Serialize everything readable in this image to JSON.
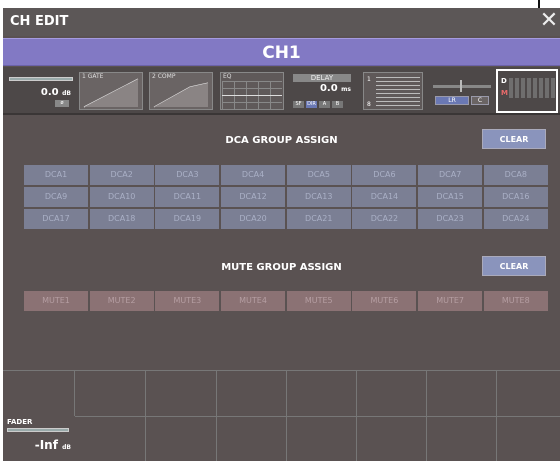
{
  "window": {
    "title": "CH EDIT",
    "close_glyph": "✕"
  },
  "channel": {
    "name": "CH1"
  },
  "strip": {
    "gain": {
      "value": "0.0",
      "unit": "dB",
      "phase_label": "ø"
    },
    "gate": {
      "label": "1 GATE"
    },
    "comp": {
      "label": "2 COMP"
    },
    "eq": {
      "label": "EQ"
    },
    "delay": {
      "label": "DELAY",
      "value": "0.0",
      "unit": "ms",
      "sw": [
        "SF",
        "DIR",
        "A",
        "B"
      ]
    },
    "insert": {
      "top": "1",
      "bottom": "8"
    },
    "pan": {
      "lr": "LR",
      "c": "C"
    },
    "assign": {
      "d": "D",
      "m": "M"
    }
  },
  "dca_section": {
    "title": "DCA GROUP ASSIGN",
    "clear_label": "CLEAR",
    "buttons": [
      "DCA1",
      "DCA2",
      "DCA3",
      "DCA4",
      "DCA5",
      "DCA6",
      "DCA7",
      "DCA8",
      "DCA9",
      "DCA10",
      "DCA11",
      "DCA12",
      "DCA13",
      "DCA14",
      "DCA15",
      "DCA16",
      "DCA17",
      "DCA18",
      "DCA19",
      "DCA20",
      "DCA21",
      "DCA22",
      "DCA23",
      "DCA24"
    ]
  },
  "mute_section": {
    "title": "MUTE GROUP ASSIGN",
    "clear_label": "CLEAR",
    "buttons": [
      "MUTE1",
      "MUTE2",
      "MUTE3",
      "MUTE4",
      "MUTE5",
      "MUTE6",
      "MUTE7",
      "MUTE8"
    ]
  },
  "fader": {
    "label": "FADER",
    "value": "-Inf",
    "unit": "dB"
  },
  "colors": {
    "accent": "#8279c4",
    "dca": "#7b7f94",
    "mute": "#8b7274",
    "clear": "#8a94bc"
  }
}
